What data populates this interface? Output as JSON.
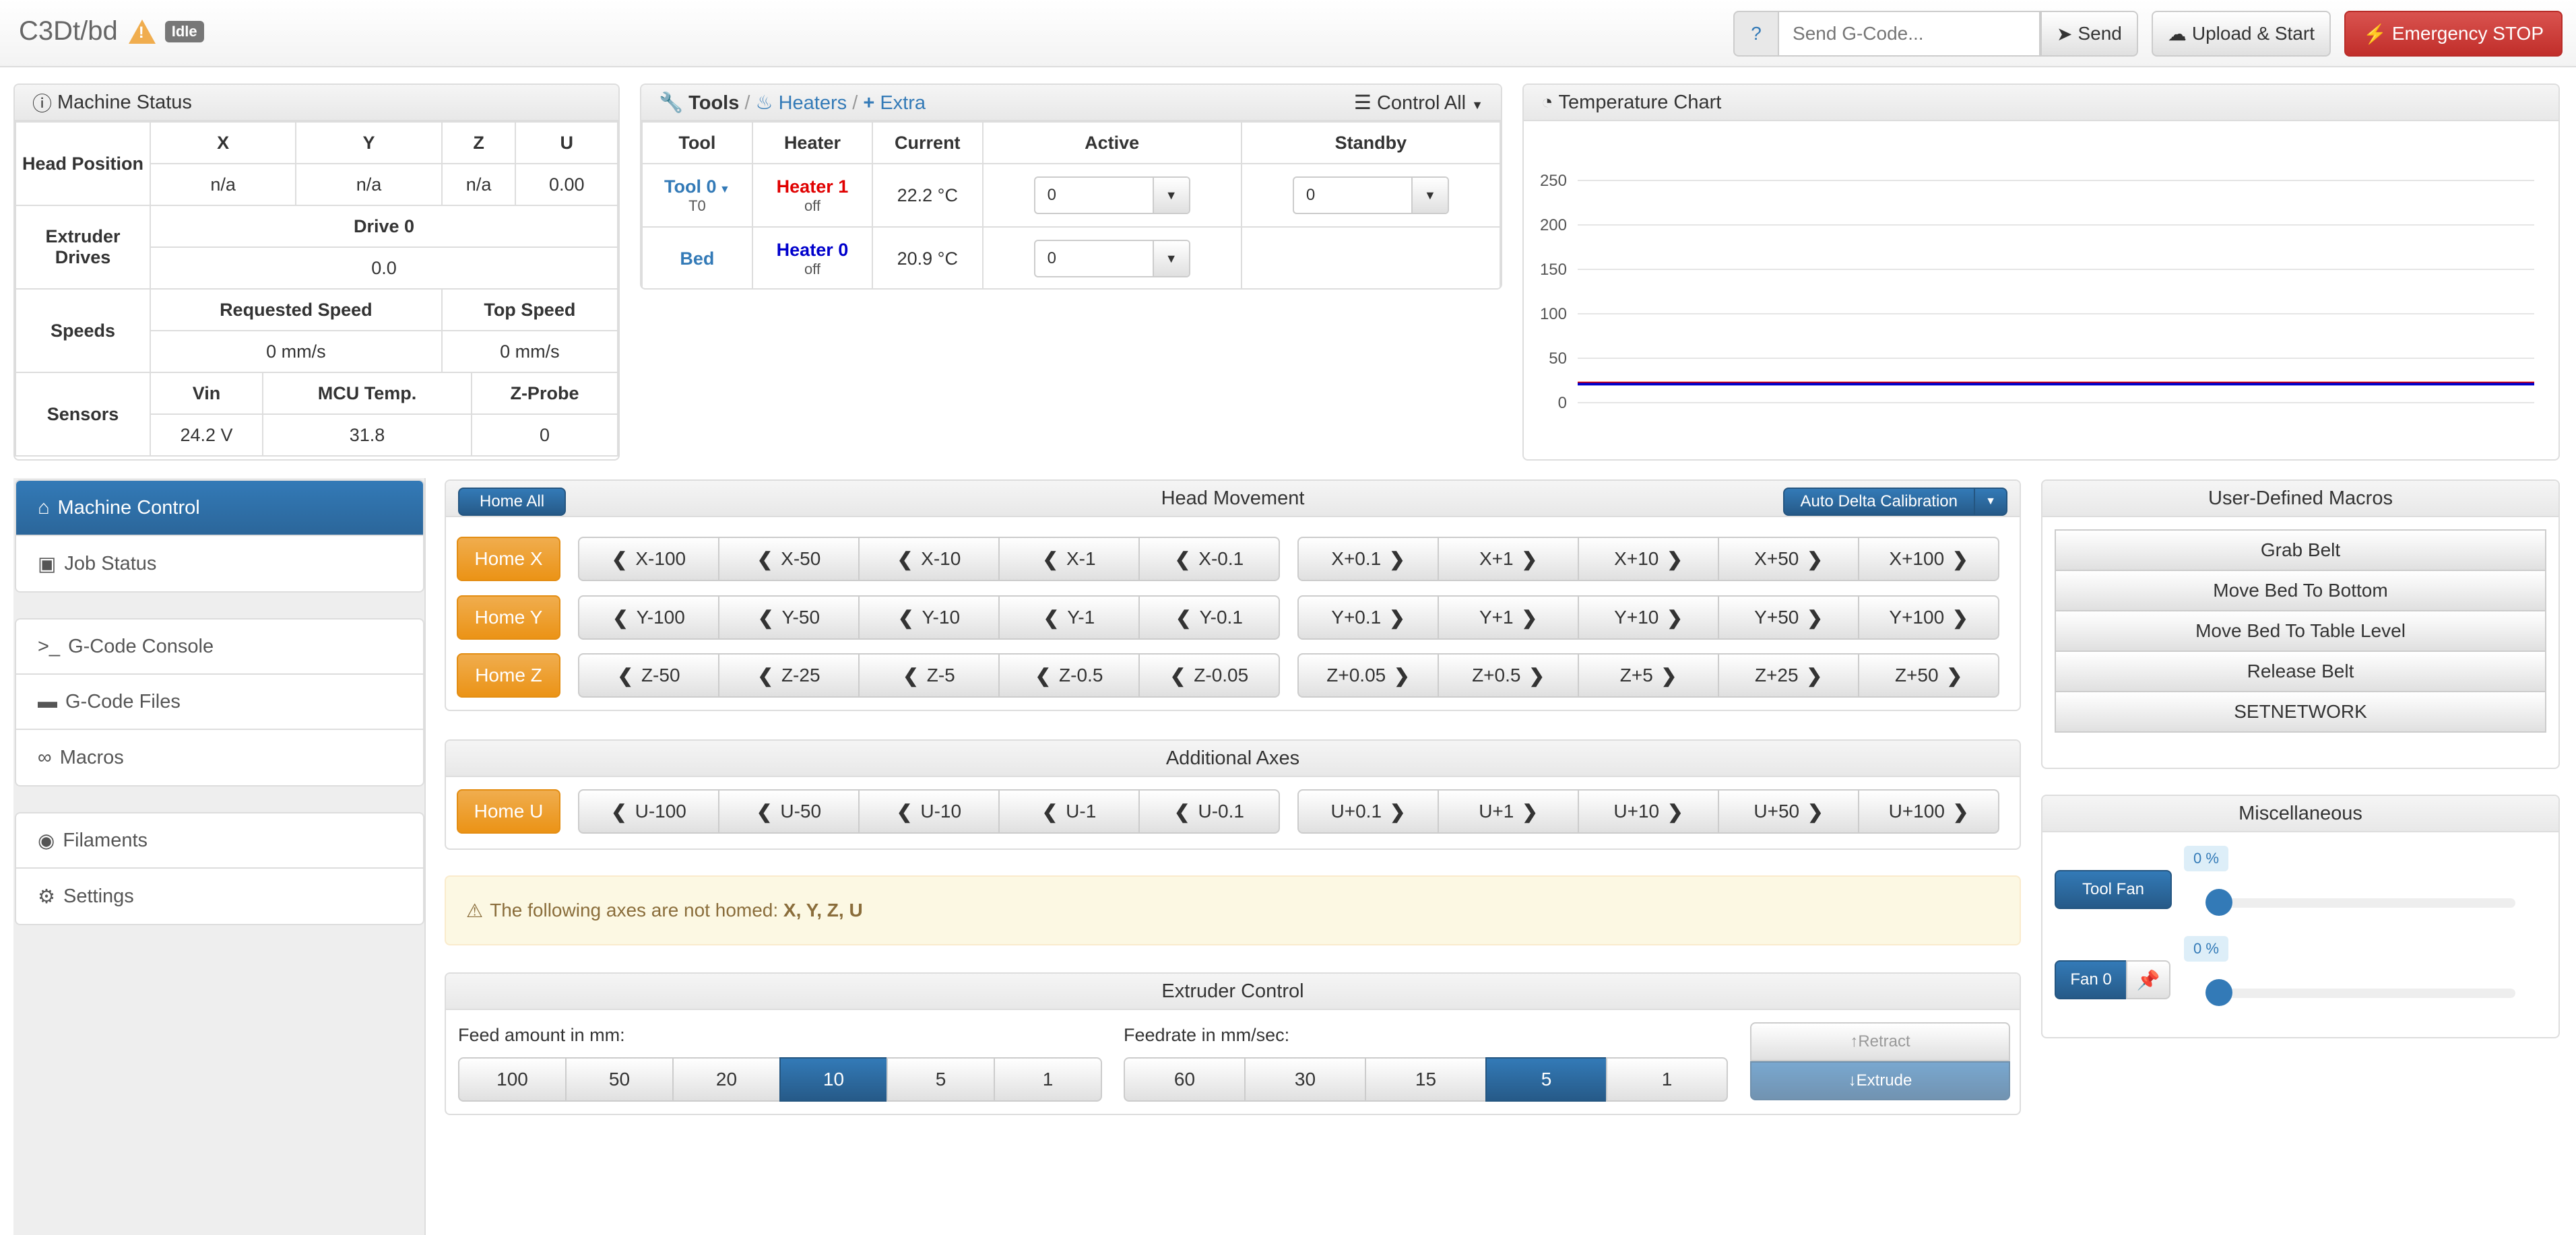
{
  "nav": {
    "title": "C3Dt/bd",
    "status": "Idle",
    "help": "?",
    "gcode_placeholder": "Send G-Code...",
    "send": "Send",
    "upload": "Upload & Start",
    "estop": "Emergency STOP"
  },
  "machine_status": {
    "title": "Machine Status",
    "head_label": "Head Position",
    "axes": [
      "X",
      "Y",
      "Z",
      "U"
    ],
    "positions": [
      "n/a",
      "n/a",
      "n/a",
      "0.00"
    ],
    "extruder_label": "Extruder Drives",
    "drive_name": "Drive 0",
    "drive_value": "0.0",
    "speeds_label": "Speeds",
    "req_speed_label": "Requested Speed",
    "top_speed_label": "Top Speed",
    "req_speed": "0 mm/s",
    "top_speed": "0 mm/s",
    "sensors_label": "Sensors",
    "vin_label": "Vin",
    "mcu_label": "MCU Temp.",
    "zprobe_label": "Z-Probe",
    "vin": "24.2 V",
    "mcu": "31.8",
    "zprobe": "0"
  },
  "tools": {
    "title": "Tools",
    "heaters": "Heaters",
    "extra": "Extra",
    "control_all": "Control All",
    "headers": [
      "Tool",
      "Heater",
      "Current",
      "Active",
      "Standby"
    ],
    "rows": [
      {
        "tool": "Tool 0",
        "tool_sub": "T0",
        "heater": "Heater 1",
        "heater_state": "off",
        "current": "22.2 °C",
        "active": "0",
        "standby": "0",
        "heater_color": "#e00000"
      },
      {
        "tool": "Bed",
        "tool_sub": "",
        "heater": "Heater 0",
        "heater_state": "off",
        "current": "20.9 °C",
        "active": "0",
        "standby": "",
        "heater_color": "#0000cc"
      }
    ]
  },
  "temp_chart": {
    "title": "Temperature Chart",
    "chart_data": {
      "type": "line",
      "yticks": [
        0,
        50,
        100,
        150,
        200,
        250
      ],
      "ylim": [
        0,
        250
      ],
      "series": [
        {
          "color": "#e00000",
          "values": [
            22.2,
            22.2
          ]
        },
        {
          "color": "#0000cc",
          "values": [
            20.9,
            20.9
          ]
        }
      ]
    }
  },
  "sidebar": {
    "group1": [
      {
        "label": "Machine Control",
        "icon": "home-icon",
        "glyph": "⌂"
      },
      {
        "label": "Job Status",
        "icon": "print-icon",
        "glyph": "▣"
      }
    ],
    "group2": [
      {
        "label": "G-Code Console",
        "icon": "terminal-icon",
        "glyph": ">_"
      },
      {
        "label": "G-Code Files",
        "icon": "hdd-icon",
        "glyph": "▬"
      },
      {
        "label": "Macros",
        "icon": "link-icon",
        "glyph": "∞"
      }
    ],
    "group3": [
      {
        "label": "Filaments",
        "icon": "disc-icon",
        "glyph": "◉"
      },
      {
        "label": "Settings",
        "icon": "gear-icon",
        "glyph": "⚙"
      }
    ]
  },
  "head_movement": {
    "title": "Head Movement",
    "home_all": "Home All",
    "auto_delta": "Auto Delta Calibration",
    "rows": [
      {
        "home": "Home X",
        "neg": [
          "X-100",
          "X-50",
          "X-10",
          "X-1",
          "X-0.1"
        ],
        "pos": [
          "X+0.1",
          "X+1",
          "X+10",
          "X+50",
          "X+100"
        ]
      },
      {
        "home": "Home Y",
        "neg": [
          "Y-100",
          "Y-50",
          "Y-10",
          "Y-1",
          "Y-0.1"
        ],
        "pos": [
          "Y+0.1",
          "Y+1",
          "Y+10",
          "Y+50",
          "Y+100"
        ]
      },
      {
        "home": "Home Z",
        "neg": [
          "Z-50",
          "Z-25",
          "Z-5",
          "Z-0.5",
          "Z-0.05"
        ],
        "pos": [
          "Z+0.05",
          "Z+0.5",
          "Z+5",
          "Z+25",
          "Z+50"
        ]
      }
    ]
  },
  "additional_axes": {
    "title": "Additional Axes",
    "home": "Home U",
    "neg": [
      "U-100",
      "U-50",
      "U-10",
      "U-1",
      "U-0.1"
    ],
    "pos": [
      "U+0.1",
      "U+1",
      "U+10",
      "U+50",
      "U+100"
    ]
  },
  "alert": {
    "text": "The following axes are not homed: ",
    "axes": "X, Y, Z, U"
  },
  "extruder": {
    "title": "Extruder Control",
    "feed_label": "Feed amount in mm:",
    "feed_options": [
      "100",
      "50",
      "20",
      "10",
      "5",
      "1"
    ],
    "feed_selected": "10",
    "rate_label": "Feedrate in mm/sec:",
    "rate_options": [
      "60",
      "30",
      "15",
      "5",
      "1"
    ],
    "rate_selected": "5",
    "retract": "Retract",
    "extrude": "Extrude"
  },
  "macros": {
    "title": "User-Defined Macros",
    "items": [
      "Grab Belt",
      "Move Bed To Bottom",
      "Move Bed To Table Level",
      "Release Belt",
      "SETNETWORK"
    ]
  },
  "misc": {
    "title": "Miscellaneous",
    "fans": [
      {
        "label": "Tool Fan",
        "value": "0 %",
        "level": 0
      },
      {
        "label": "Fan 0",
        "value": "0 %",
        "level": 0
      }
    ]
  }
}
